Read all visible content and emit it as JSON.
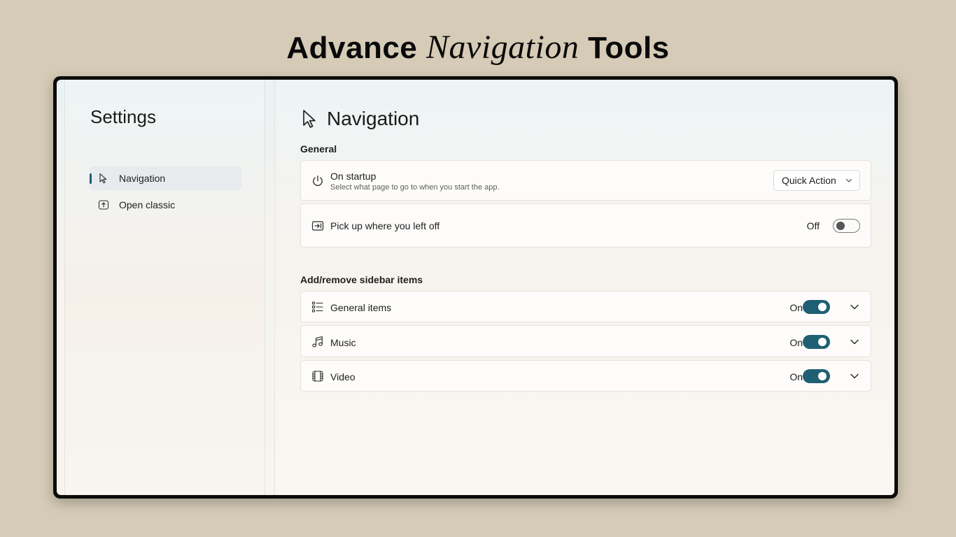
{
  "promo": {
    "title_part1": "Advance",
    "title_part2": "Navigation",
    "title_part3": "Tools"
  },
  "sidebar": {
    "title": "Settings",
    "items": [
      {
        "label": "Navigation",
        "icon": "cursor-icon",
        "active": true
      },
      {
        "label": "Open classic",
        "icon": "open-app-icon",
        "active": false
      }
    ]
  },
  "page": {
    "title": "Navigation",
    "icon": "cursor-icon"
  },
  "general": {
    "section_label": "General",
    "startup": {
      "label": "On startup",
      "description": "Select what page to go to when you start the app.",
      "icon": "power-icon",
      "dropdown_value": "Quick Action"
    },
    "pickup": {
      "label": "Pick up where you left off",
      "icon": "resume-icon",
      "state": "Off",
      "enabled": false
    }
  },
  "sidebar_items_section": {
    "section_label": "Add/remove sidebar items",
    "rows": [
      {
        "label": "General items",
        "icon": "list-icon",
        "state": "On",
        "enabled": true
      },
      {
        "label": "Music",
        "icon": "music-note-icon",
        "state": "On",
        "enabled": true
      },
      {
        "label": "Video",
        "icon": "film-icon",
        "state": "On",
        "enabled": true
      }
    ]
  },
  "colors": {
    "accent": "#1f5f73",
    "background": "#d5cbb6",
    "frame": "#0b0b0b"
  }
}
